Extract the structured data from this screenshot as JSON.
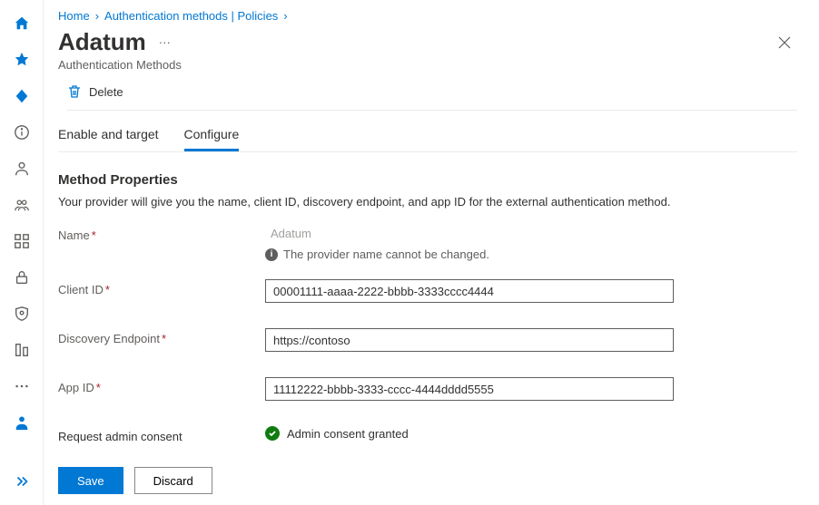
{
  "breadcrumb": {
    "items": [
      "Home",
      "Authentication methods | Policies"
    ]
  },
  "header": {
    "title": "Adatum",
    "subtitle": "Authentication Methods"
  },
  "toolbar": {
    "delete_label": "Delete"
  },
  "tabs": {
    "enable_target": "Enable and target",
    "configure": "Configure"
  },
  "section": {
    "title": "Method Properties",
    "description": "Your provider will give you the name, client ID, discovery endpoint, and app ID for the external authentication method."
  },
  "form": {
    "name_label": "Name",
    "name_value": "Adatum",
    "name_info": "The provider name cannot be changed.",
    "client_id_label": "Client ID",
    "client_id_value": "00001111-aaaa-2222-bbbb-3333cccc4444",
    "discovery_label": "Discovery Endpoint",
    "discovery_value": "https://contoso",
    "app_id_label": "App ID",
    "app_id_value": "11112222-bbbb-3333-cccc-4444dddd5555",
    "consent_label": "Request admin consent",
    "consent_status": "Admin consent granted"
  },
  "footer": {
    "save": "Save",
    "discard": "Discard"
  }
}
